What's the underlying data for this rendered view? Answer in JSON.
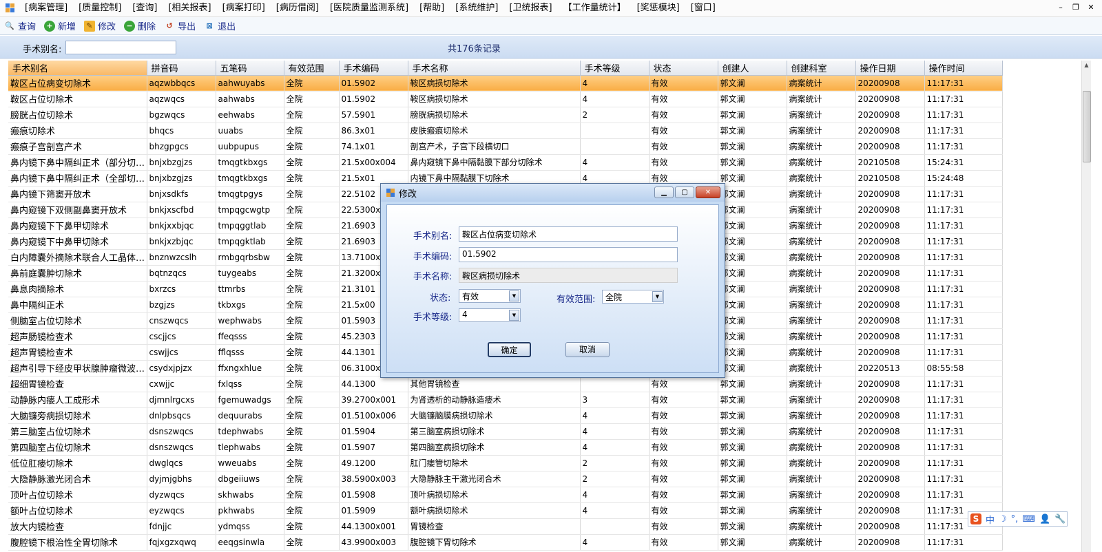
{
  "menu": {
    "items": [
      "[病案管理]",
      "[质量控制]",
      "[查询]",
      "[相关报表]",
      "[病案打印]",
      "[病历借阅]",
      "[医院质量监测系统]",
      "[帮助]",
      "[系统维护]",
      "[卫统报表]",
      "【工作量统计】",
      "[奖惩模块]",
      "[窗口]"
    ]
  },
  "window_controls": {
    "minimize": "–",
    "restore": "❐",
    "close": "✕"
  },
  "toolbar": {
    "items": [
      {
        "label": "查询",
        "icon": "search-icon",
        "glyph": "🔍"
      },
      {
        "label": "新增",
        "icon": "add-icon",
        "glyph": "+"
      },
      {
        "label": "修改",
        "icon": "edit-icon",
        "glyph": "✎"
      },
      {
        "label": "删除",
        "icon": "delete-icon",
        "glyph": "−"
      },
      {
        "label": "导出",
        "icon": "export-icon",
        "glyph": "↺"
      },
      {
        "label": "退出",
        "icon": "exit-icon",
        "glyph": "⊠"
      }
    ]
  },
  "filter": {
    "label": "手术别名:",
    "value": "",
    "record_count": "共176条记录"
  },
  "table": {
    "columns": [
      "手术别名",
      "拼音码",
      "五笔码",
      "有效范围",
      "手术编码",
      "手术名称",
      "手术等级",
      "状态",
      "创建人",
      "创建科室",
      "操作日期",
      "操作时间"
    ],
    "rows": [
      [
        "鞍区占位病变切除术",
        "aqzwbbqcs",
        "aahwuyabs",
        "全院",
        "01.5902",
        "鞍区病损切除术",
        "4",
        "有效",
        "郭文澜",
        "病案统计",
        "20200908",
        "11:17:31"
      ],
      [
        "鞍区占位切除术",
        "aqzwqcs",
        "aahwabs",
        "全院",
        "01.5902",
        "鞍区病损切除术",
        "4",
        "有效",
        "郭文澜",
        "病案统计",
        "20200908",
        "11:17:31"
      ],
      [
        "膀胱占位切除术",
        "bgzwqcs",
        "eehwabs",
        "全院",
        "57.5901",
        "膀胱病损切除术",
        "2",
        "有效",
        "郭文澜",
        "病案统计",
        "20200908",
        "11:17:31"
      ],
      [
        "瘢痕切除术",
        "bhqcs",
        "uuabs",
        "全院",
        "86.3x01",
        "皮肤瘢痕切除术",
        "",
        "有效",
        "郭文澜",
        "病案统计",
        "20200908",
        "11:17:31"
      ],
      [
        "瘢痕子宫剖宫产术",
        "bhzgpgcs",
        "uubpupus",
        "全院",
        "74.1x01",
        "剖宫产术，子宫下段横切口",
        "",
        "有效",
        "郭文澜",
        "病案统计",
        "20200908",
        "11:17:31"
      ],
      [
        "鼻内镜下鼻中隔纠正术（部分切除）",
        "bnjxbzgjzs",
        "tmqgtkbxgs",
        "全院",
        "21.5x00x004",
        "鼻内窥镜下鼻中隔黏膜下部分切除术",
        "4",
        "有效",
        "郭文澜",
        "病案统计",
        "20210508",
        "15:24:31"
      ],
      [
        "鼻内镜下鼻中隔纠正术（全部切除）",
        "bnjxbzgjzs",
        "tmqgtkbxgs",
        "全院",
        "21.5x01",
        "内镜下鼻中隔黏膜下切除术",
        "4",
        "有效",
        "郭文澜",
        "病案统计",
        "20210508",
        "15:24:48"
      ],
      [
        "鼻内镜下筛窦开放术",
        "bnjxsdkfs",
        "tmqgtpgys",
        "全院",
        "22.5102",
        "",
        "",
        "",
        "郭文澜",
        "病案统计",
        "20200908",
        "11:17:31"
      ],
      [
        "鼻内窥镜下双侧副鼻窦开放术",
        "bnkjxscfbd",
        "tmpqgcwgtp",
        "全院",
        "22.5300x0",
        "",
        "",
        "",
        "郭文澜",
        "病案统计",
        "20200908",
        "11:17:31"
      ],
      [
        "鼻内窥镜下下鼻甲切除术",
        "bnkjxxbjqc",
        "tmpqggtlab",
        "全院",
        "21.6903",
        "",
        "",
        "",
        "郭文澜",
        "病案统计",
        "20200908",
        "11:17:31"
      ],
      [
        "鼻内窥镜下中鼻甲切除术",
        "bnkjxzbjqc",
        "tmpqgktlab",
        "全院",
        "21.6903",
        "",
        "",
        "",
        "郭文澜",
        "病案统计",
        "20200908",
        "11:17:31"
      ],
      [
        "白内障囊外摘除术联合人工晶体植入术",
        "bnznwzcslh",
        "rmbgqrbsbw",
        "全院",
        "13.7100x0",
        "",
        "",
        "",
        "郭文澜",
        "病案统计",
        "20200908",
        "11:17:31"
      ],
      [
        "鼻前庭囊肿切除术",
        "bqtnzqcs",
        "tuygeabs",
        "全院",
        "21.3200x0",
        "",
        "",
        "",
        "郭文澜",
        "病案统计",
        "20200908",
        "11:17:31"
      ],
      [
        "鼻息肉摘除术",
        "bxrzcs",
        "ttmrbs",
        "全院",
        "21.3101",
        "",
        "",
        "",
        "郭文澜",
        "病案统计",
        "20200908",
        "11:17:31"
      ],
      [
        "鼻中隔纠正术",
        "bzgjzs",
        "tkbxgs",
        "全院",
        "21.5x00",
        "",
        "",
        "",
        "郭文澜",
        "病案统计",
        "20200908",
        "11:17:31"
      ],
      [
        "侧脑室占位切除术",
        "cnszwqcs",
        "wephwabs",
        "全院",
        "01.5903",
        "",
        "",
        "",
        "郭文澜",
        "病案统计",
        "20200908",
        "11:17:31"
      ],
      [
        "超声肠镜检查术",
        "cscjjcs",
        "ffeqsss",
        "全院",
        "45.2303",
        "",
        "",
        "",
        "郭文澜",
        "病案统计",
        "20200908",
        "11:17:31"
      ],
      [
        "超声胃镜检查术",
        "cswjjcs",
        "fflqsss",
        "全院",
        "44.1301",
        "",
        "",
        "",
        "郭文澜",
        "病案统计",
        "20200908",
        "11:17:31"
      ],
      [
        "超声引导下经皮甲状腺肿瘤微波消融术",
        "csydxjpjzx",
        "ffxngxhlue",
        "全院",
        "06.3100x0",
        "",
        "",
        "",
        "郭文澜",
        "病案统计",
        "20220513",
        "08:55:58"
      ],
      [
        "超细胃镜检查",
        "cxwjjc",
        "fxlqss",
        "全院",
        "44.1300",
        "其他胃镜检查",
        "",
        "有效",
        "郭文澜",
        "病案统计",
        "20200908",
        "11:17:31"
      ],
      [
        "动静脉内瘘人工成形术",
        "djmnlrgcxs",
        "fgemuwadgs",
        "全院",
        "39.2700x001",
        "为肾透析的动静脉造瘘术",
        "3",
        "有效",
        "郭文澜",
        "病案统计",
        "20200908",
        "11:17:31"
      ],
      [
        "大脑镰旁病损切除术",
        "dnlpbsqcs",
        "dequurabs",
        "全院",
        "01.5100x006",
        "大脑镰脑膜病损切除术",
        "4",
        "有效",
        "郭文澜",
        "病案统计",
        "20200908",
        "11:17:31"
      ],
      [
        "第三脑室占位切除术",
        "dsnszwqcs",
        "tdephwabs",
        "全院",
        "01.5904",
        "第三脑室病损切除术",
        "4",
        "有效",
        "郭文澜",
        "病案统计",
        "20200908",
        "11:17:31"
      ],
      [
        "第四脑室占位切除术",
        "dsnszwqcs",
        "tlephwabs",
        "全院",
        "01.5907",
        "第四脑室病损切除术",
        "4",
        "有效",
        "郭文澜",
        "病案统计",
        "20200908",
        "11:17:31"
      ],
      [
        "低位肛瘘切除术",
        "dwglqcs",
        "wweuabs",
        "全院",
        "49.1200",
        "肛门瘘管切除术",
        "2",
        "有效",
        "郭文澜",
        "病案统计",
        "20200908",
        "11:17:31"
      ],
      [
        "大隐静脉激光闭合术",
        "dyjmjgbhs",
        "dbgeiiuws",
        "全院",
        "38.5900x003",
        "大隐静脉主干激光闭合术",
        "2",
        "有效",
        "郭文澜",
        "病案统计",
        "20200908",
        "11:17:31"
      ],
      [
        "顶叶占位切除术",
        "dyzwqcs",
        "skhwabs",
        "全院",
        "01.5908",
        "顶叶病损切除术",
        "4",
        "有效",
        "郭文澜",
        "病案统计",
        "20200908",
        "11:17:31"
      ],
      [
        "额叶占位切除术",
        "eyzwqcs",
        "pkhwabs",
        "全院",
        "01.5909",
        "额叶病损切除术",
        "4",
        "有效",
        "郭文澜",
        "病案统计",
        "20200908",
        "11:17:31"
      ],
      [
        "放大内镜检查",
        "fdnjjc",
        "ydmqss",
        "全院",
        "44.1300x001",
        "胃镜检查",
        "",
        "有效",
        "郭文澜",
        "病案统计",
        "20200908",
        "11:17:31"
      ],
      [
        "腹腔镜下根治性全胃切除术",
        "fqjxgzxqwq",
        "eeqgsinwla",
        "全院",
        "43.9900x003",
        "腹腔镜下胃切除术",
        "4",
        "有效",
        "郭文澜",
        "病案统计",
        "20200908",
        "11:17:31"
      ]
    ]
  },
  "dialog": {
    "title": "修改",
    "labels": {
      "alias": "手术别名:",
      "code": "手术编码:",
      "name": "手术名称:",
      "status": "状态:",
      "scope": "有效范围:",
      "level": "手术等级:"
    },
    "values": {
      "alias": "鞍区占位病变切除术",
      "code": "01.5902",
      "name": "鞍区病损切除术",
      "status": "有效",
      "scope": "全院",
      "level": "4"
    },
    "buttons": {
      "ok": "确定",
      "cancel": "取消"
    },
    "window_controls": {
      "minimize": "▁",
      "maximize": "▢",
      "close": "✕"
    }
  },
  "ime": {
    "items": [
      "S",
      "中",
      "☽",
      "°,",
      "⌨",
      "👤",
      "🔧"
    ]
  },
  "colors": {
    "selected_row": "#f9ad45",
    "header_bg": "#e3e7ee",
    "toolbar_text": "#1a2a8a",
    "dialog_bg": "#c7dcf4"
  }
}
